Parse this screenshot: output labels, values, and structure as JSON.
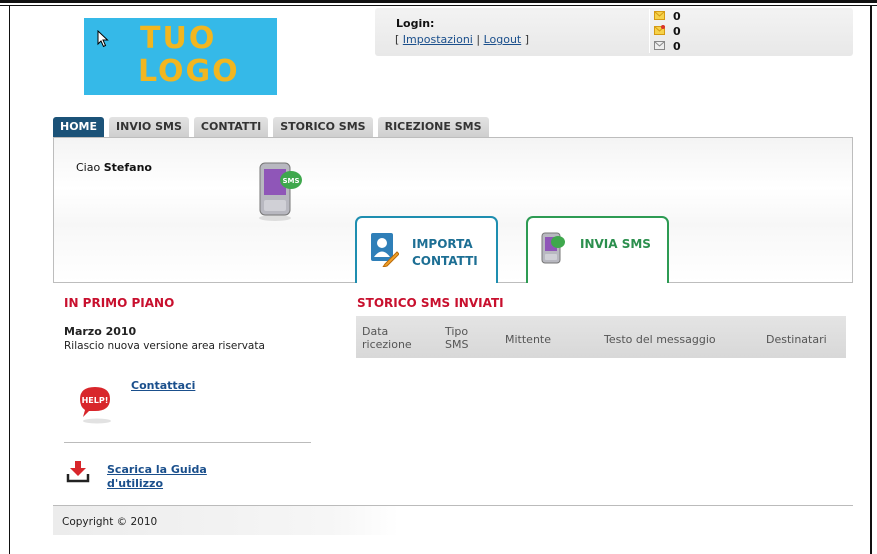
{
  "logo": {
    "line1": "TUO",
    "line2": "LOGO"
  },
  "login": {
    "label": "Login:",
    "open_bracket": "[",
    "settings_link": "Impostazioni",
    "pipe": "|",
    "logout_link": "Logout",
    "close_bracket": "]"
  },
  "counters": [
    {
      "icon": "new-mail-icon",
      "value": "0"
    },
    {
      "icon": "sent-mail-icon",
      "value": "0"
    },
    {
      "icon": "mail-icon",
      "value": "0"
    }
  ],
  "tabs": [
    {
      "label": "HOME",
      "active": true
    },
    {
      "label": "INVIO SMS",
      "active": false
    },
    {
      "label": "CONTATTI",
      "active": false
    },
    {
      "label": "STORICO SMS",
      "active": false
    },
    {
      "label": "RICEZIONE SMS",
      "active": false
    }
  ],
  "welcome": {
    "prefix": "Ciao",
    "name": "Stefano",
    "phone_badge": "SMS"
  },
  "actions": {
    "import": {
      "line1": "IMPORTA",
      "line2": "CONTATTI"
    },
    "send": {
      "label": "INVIA SMS"
    }
  },
  "featured": {
    "title": "IN PRIMO PIANO",
    "news_date": "Marzo 2010",
    "news_text": "Rilascio nuova versione area riservata",
    "help_badge": "HELP!",
    "contact_link": "Contattaci",
    "guide_link_line1": "Scarica la Guida",
    "guide_link_line2": "d'utilizzo"
  },
  "history": {
    "title": "STORICO SMS INVIATI",
    "columns": [
      {
        "line1": "Data",
        "line2": "ricezione"
      },
      {
        "line1": "Tipo",
        "line2": "SMS"
      },
      {
        "line1": "Mittente",
        "line2": ""
      },
      {
        "line1": "Testo del messaggio",
        "line2": ""
      },
      {
        "line1": "Destinatari",
        "line2": ""
      }
    ]
  },
  "footer": {
    "copyright": "Copyright © 2010"
  },
  "colors": {
    "tab_active": "#1b5278",
    "section_title": "#c8102e",
    "logo_bg": "#35b9e8",
    "logo_text": "#f2b61f",
    "import_border": "#1e8eb0",
    "send_border": "#2d9b53"
  }
}
